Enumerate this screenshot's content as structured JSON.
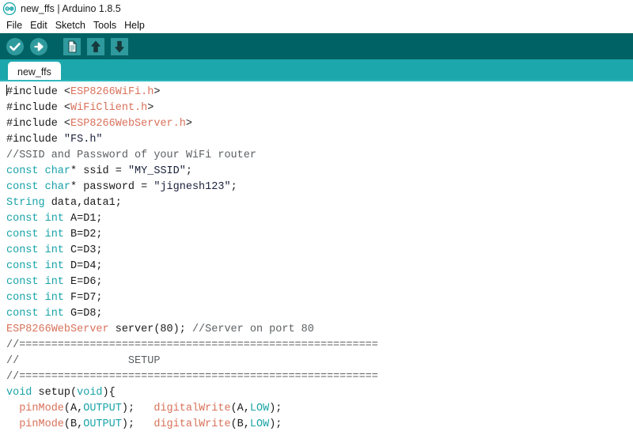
{
  "window": {
    "title": "new_ffs | Arduino 1.8.5",
    "logo_icon": "arduino-infinity-logo"
  },
  "menubar": {
    "items": [
      {
        "label": "File"
      },
      {
        "label": "Edit"
      },
      {
        "label": "Sketch"
      },
      {
        "label": "Tools"
      },
      {
        "label": "Help"
      }
    ]
  },
  "toolbar": {
    "background": "#006264",
    "buttons": [
      {
        "name": "verify-button",
        "icon": "checkmark-icon",
        "tooltip": "Verify"
      },
      {
        "name": "upload-button",
        "icon": "arrow-right-icon",
        "tooltip": "Upload"
      },
      {
        "name": "new-button",
        "icon": "document-icon",
        "tooltip": "New"
      },
      {
        "name": "open-button",
        "icon": "arrow-up-icon",
        "tooltip": "Open"
      },
      {
        "name": "save-button",
        "icon": "arrow-down-icon",
        "tooltip": "Save"
      }
    ]
  },
  "tabstrip": {
    "background": "#1CA7AC",
    "tabs": [
      {
        "label": "new_ffs",
        "active": true
      }
    ]
  },
  "editor": {
    "colors": {
      "keyword": "#1aa3a8",
      "library": "#d9725b",
      "function": "#d9725b",
      "comment": "#5c6063",
      "string": "#19203a",
      "default": "#1a1a1a"
    },
    "lines": [
      {
        "id": "l1",
        "tokens": [
          {
            "t": "caret",
            "v": ""
          },
          {
            "t": "preproc",
            "v": "#include "
          },
          {
            "t": "default",
            "v": "<"
          },
          {
            "t": "lib",
            "v": "ESP8266WiFi.h"
          },
          {
            "t": "default",
            "v": ">"
          }
        ]
      },
      {
        "id": "l2",
        "tokens": [
          {
            "t": "preproc",
            "v": "#include "
          },
          {
            "t": "default",
            "v": "<"
          },
          {
            "t": "lib",
            "v": "WiFiClient.h"
          },
          {
            "t": "default",
            "v": ">"
          }
        ]
      },
      {
        "id": "l3",
        "tokens": [
          {
            "t": "preproc",
            "v": "#include "
          },
          {
            "t": "default",
            "v": "<"
          },
          {
            "t": "lib",
            "v": "ESP8266WebServer.h"
          },
          {
            "t": "default",
            "v": ">"
          }
        ]
      },
      {
        "id": "l4",
        "tokens": [
          {
            "t": "preproc",
            "v": "#include "
          },
          {
            "t": "string",
            "v": "\"FS.h\""
          }
        ]
      },
      {
        "id": "l5",
        "tokens": [
          {
            "t": "comment",
            "v": "//SSID and Password of your WiFi router"
          }
        ]
      },
      {
        "id": "l6",
        "tokens": [
          {
            "t": "keyword",
            "v": "const "
          },
          {
            "t": "type",
            "v": "char"
          },
          {
            "t": "default",
            "v": "* ssid = "
          },
          {
            "t": "string",
            "v": "\"MY_SSID\""
          },
          {
            "t": "default",
            "v": ";"
          }
        ]
      },
      {
        "id": "l7",
        "tokens": [
          {
            "t": "keyword",
            "v": "const "
          },
          {
            "t": "type",
            "v": "char"
          },
          {
            "t": "default",
            "v": "* password = "
          },
          {
            "t": "string",
            "v": "\"jignesh123\""
          },
          {
            "t": "default",
            "v": ";"
          }
        ]
      },
      {
        "id": "l8",
        "tokens": [
          {
            "t": "type",
            "v": "String"
          },
          {
            "t": "default",
            "v": " data,data1;"
          }
        ]
      },
      {
        "id": "l9",
        "tokens": [
          {
            "t": "keyword",
            "v": "const "
          },
          {
            "t": "type",
            "v": "int"
          },
          {
            "t": "default",
            "v": " A=D1;"
          }
        ]
      },
      {
        "id": "l10",
        "tokens": [
          {
            "t": "keyword",
            "v": "const "
          },
          {
            "t": "type",
            "v": "int"
          },
          {
            "t": "default",
            "v": " B=D2;"
          }
        ]
      },
      {
        "id": "l11",
        "tokens": [
          {
            "t": "keyword",
            "v": "const "
          },
          {
            "t": "type",
            "v": "int"
          },
          {
            "t": "default",
            "v": " C=D3;"
          }
        ]
      },
      {
        "id": "l12",
        "tokens": [
          {
            "t": "keyword",
            "v": "const "
          },
          {
            "t": "type",
            "v": "int"
          },
          {
            "t": "default",
            "v": " D=D4;"
          }
        ]
      },
      {
        "id": "l13",
        "tokens": [
          {
            "t": "keyword",
            "v": "const "
          },
          {
            "t": "type",
            "v": "int"
          },
          {
            "t": "default",
            "v": " E=D6;"
          }
        ]
      },
      {
        "id": "l14",
        "tokens": [
          {
            "t": "keyword",
            "v": "const "
          },
          {
            "t": "type",
            "v": "int"
          },
          {
            "t": "default",
            "v": " F=D7;"
          }
        ]
      },
      {
        "id": "l15",
        "tokens": [
          {
            "t": "keyword",
            "v": "const "
          },
          {
            "t": "type",
            "v": "int"
          },
          {
            "t": "default",
            "v": " G=D8;"
          }
        ]
      },
      {
        "id": "l16",
        "tokens": [
          {
            "t": "class",
            "v": "ESP8266WebServer"
          },
          {
            "t": "default",
            "v": " server(80); "
          },
          {
            "t": "comment",
            "v": "//Server on port 80"
          }
        ]
      },
      {
        "id": "l17",
        "tokens": [
          {
            "t": "comment",
            "v": "//========================================================"
          }
        ]
      },
      {
        "id": "l18",
        "tokens": [
          {
            "t": "comment",
            "v": "//                 SETUP"
          }
        ]
      },
      {
        "id": "l19",
        "tokens": [
          {
            "t": "comment",
            "v": "//========================================================"
          }
        ]
      },
      {
        "id": "l20",
        "tokens": [
          {
            "t": "type",
            "v": "void"
          },
          {
            "t": "default",
            "v": " setup("
          },
          {
            "t": "type",
            "v": "void"
          },
          {
            "t": "default",
            "v": "){"
          }
        ]
      },
      {
        "id": "l21",
        "tokens": [
          {
            "t": "default",
            "v": "  "
          },
          {
            "t": "func",
            "v": "pinMode"
          },
          {
            "t": "default",
            "v": "(A,"
          },
          {
            "t": "const",
            "v": "OUTPUT"
          },
          {
            "t": "default",
            "v": ");   "
          },
          {
            "t": "func",
            "v": "digitalWrite"
          },
          {
            "t": "default",
            "v": "(A,"
          },
          {
            "t": "const",
            "v": "LOW"
          },
          {
            "t": "default",
            "v": ");"
          }
        ]
      },
      {
        "id": "l22",
        "tokens": [
          {
            "t": "default",
            "v": "  "
          },
          {
            "t": "func",
            "v": "pinMode"
          },
          {
            "t": "default",
            "v": "(B,"
          },
          {
            "t": "const",
            "v": "OUTPUT"
          },
          {
            "t": "default",
            "v": ");   "
          },
          {
            "t": "func",
            "v": "digitalWrite"
          },
          {
            "t": "default",
            "v": "(B,"
          },
          {
            "t": "const",
            "v": "LOW"
          },
          {
            "t": "default",
            "v": ");"
          }
        ]
      }
    ]
  }
}
